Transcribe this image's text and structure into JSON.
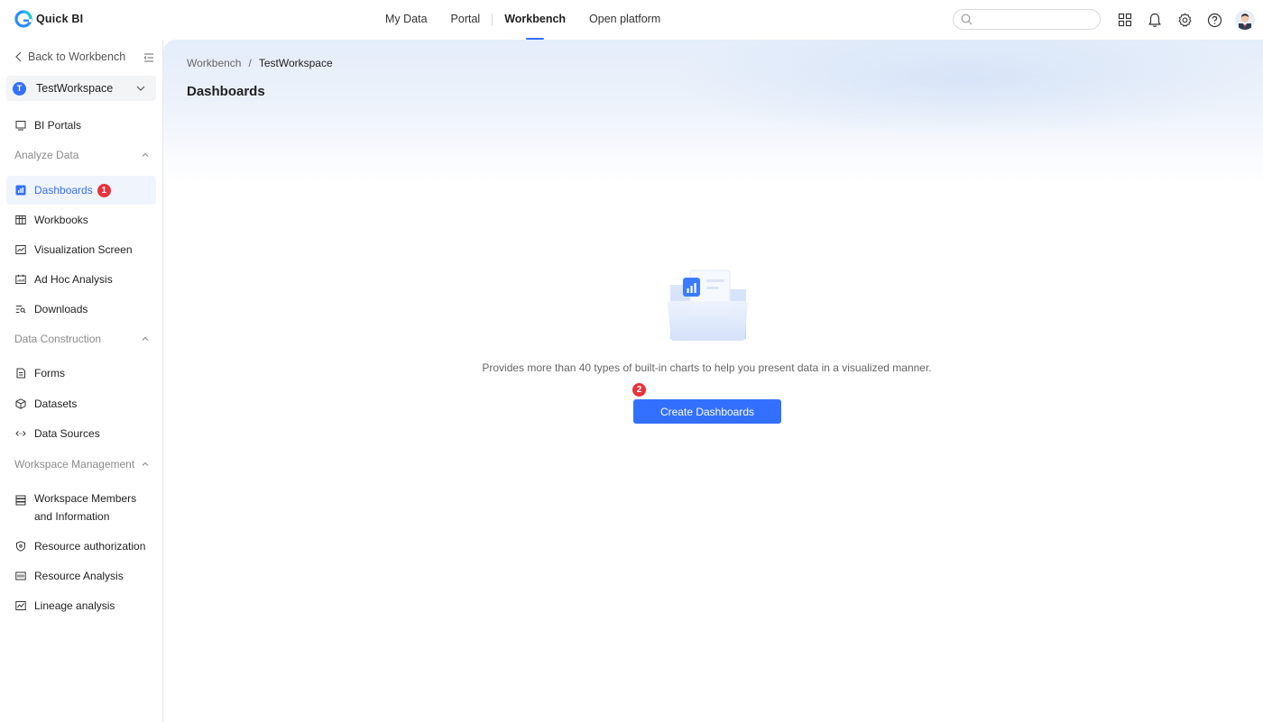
{
  "app": {
    "name": "Quick BI"
  },
  "nav": {
    "items": [
      "My Data",
      "Portal",
      "Workbench",
      "Open platform"
    ],
    "active": "Workbench"
  },
  "search": {
    "placeholder": ""
  },
  "sidebar": {
    "back_label": "Back to Workbench",
    "workspace": {
      "initial": "T",
      "name": "TestWorkspace"
    },
    "bi_portals": "BI Portals",
    "group_analyze": "Analyze Data",
    "analyze_items": [
      "Dashboards",
      "Workbooks",
      "Visualization Screen",
      "Ad Hoc Analysis",
      "Downloads"
    ],
    "group_data": "Data Construction",
    "data_items": [
      "Forms",
      "Datasets",
      "Data Sources"
    ],
    "group_workspace": "Workspace Management",
    "ws_members_line1": "Workspace Members",
    "ws_members_line2": "and Information",
    "ws_items": [
      "Resource authorization",
      "Resource Analysis",
      "Lineage analysis"
    ],
    "step1": "1"
  },
  "main": {
    "breadcrumb": [
      "Workbench",
      "TestWorkspace"
    ],
    "title": "Dashboards",
    "empty_description": "Provides more than 40 types of built-in charts to help you present data in a visualized manner.",
    "create_button": "Create Dashboards",
    "step2": "2"
  },
  "colors": {
    "accent": "#3370ff",
    "badge": "#e8323c",
    "active_bg": "#f0f4fd"
  }
}
